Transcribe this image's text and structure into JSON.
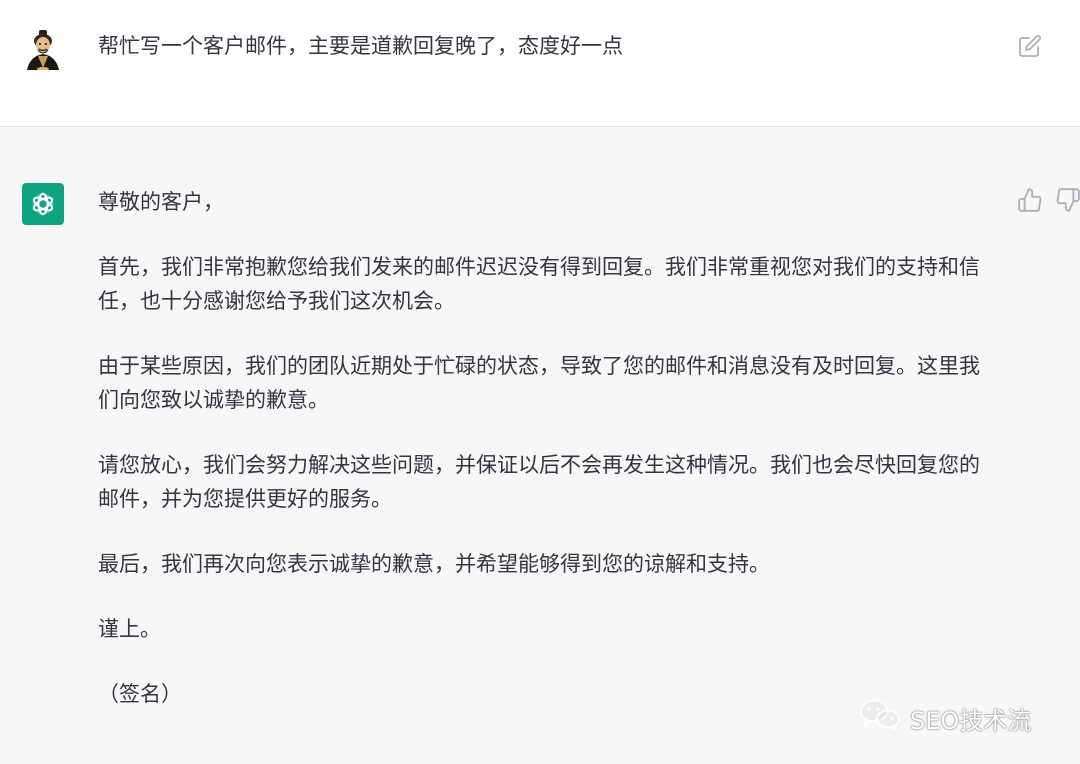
{
  "colors": {
    "assistant_bg": "#f7f7f8",
    "user_bg": "#ffffff",
    "text": "#343541",
    "brand_green": "#10a37f",
    "icon_gray": "#aeaeb6"
  },
  "user_message": {
    "avatar_icon": "user-avatar-icon",
    "text": "帮忙写一个客户邮件，主要是道歉回复晚了，态度好一点",
    "edit_icon": "edit-icon"
  },
  "assistant_message": {
    "avatar_icon": "openai-logo-icon",
    "paragraphs": [
      "尊敬的客户，",
      "首先，我们非常抱歉您给我们发来的邮件迟迟没有得到回复。我们非常重视您对我们的支持和信任，也十分感谢您给予我们这次机会。",
      "由于某些原因，我们的团队近期处于忙碌的状态，导致了您的邮件和消息没有及时回复。这里我们向您致以诚挚的歉意。",
      "请您放心，我们会努力解决这些问题，并保证以后不会再发生这种情况。我们也会尽快回复您的邮件，并为您提供更好的服务。",
      "最后，我们再次向您表示诚挚的歉意，并希望能够得到您的谅解和支持。",
      "谨上。",
      "（签名）"
    ],
    "thumbs_up_icon": "thumbs-up-icon",
    "thumbs_down_icon": "thumbs-down-icon"
  },
  "watermark": {
    "icon": "wechat-icon",
    "text": "SEO技术流"
  }
}
